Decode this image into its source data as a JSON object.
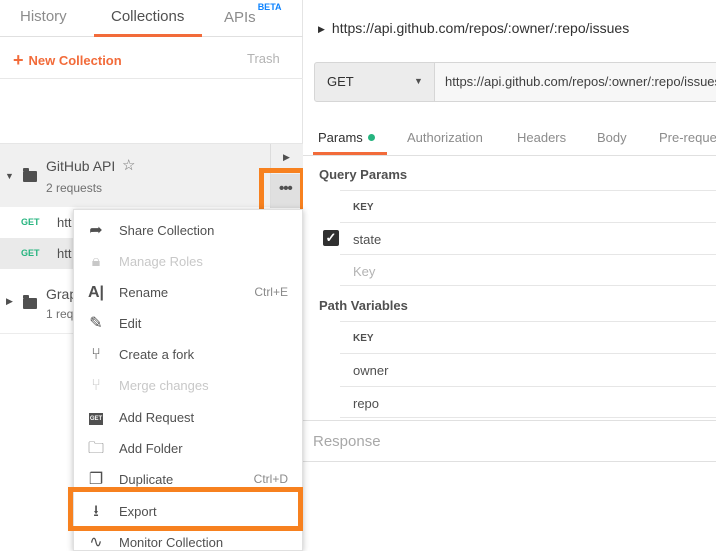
{
  "sidebar": {
    "tabs": {
      "history": "History",
      "collections": "Collections",
      "apis": "APIs",
      "apis_badge": "BETA"
    },
    "new_collection": "New Collection",
    "trash": "Trash",
    "collections": [
      {
        "name": "GitHub API",
        "count": "2 requests"
      },
      {
        "name": "Grap",
        "count": "1 req"
      }
    ],
    "requests": [
      {
        "method": "GET",
        "url": "htt"
      },
      {
        "method": "GET",
        "url": "htt"
      }
    ]
  },
  "menu": {
    "items": [
      {
        "label": "Share Collection",
        "shortcut": ""
      },
      {
        "label": "Manage Roles",
        "shortcut": ""
      },
      {
        "label": "Rename",
        "shortcut": "Ctrl+E"
      },
      {
        "label": "Edit",
        "shortcut": ""
      },
      {
        "label": "Create a fork",
        "shortcut": ""
      },
      {
        "label": "Merge changes",
        "shortcut": ""
      },
      {
        "label": "Add Request",
        "shortcut": ""
      },
      {
        "label": "Add Folder",
        "shortcut": ""
      },
      {
        "label": "Duplicate",
        "shortcut": "Ctrl+D"
      },
      {
        "label": "Export",
        "shortcut": ""
      },
      {
        "label": "Monitor Collection",
        "shortcut": ""
      }
    ],
    "get_chip": "GET"
  },
  "main": {
    "url_title": "https://api.github.com/repos/:owner/:repo/issues",
    "method": "GET",
    "url_value": "https://api.github.com/repos/:owner/:repo/issues",
    "tabs": {
      "params": "Params",
      "authorization": "Authorization",
      "headers": "Headers",
      "body": "Body",
      "pre": "Pre-reque"
    },
    "query_params": {
      "title": "Query Params",
      "key_header": "KEY",
      "row1": "state",
      "placeholder": "Key"
    },
    "path_variables": {
      "title": "Path Variables",
      "key_header": "KEY",
      "row1": "owner",
      "row2": "repo"
    },
    "response": "Response"
  },
  "colors": {
    "accent": "#f26b3a",
    "highlight": "#f7811f",
    "get_method": "#26b47f",
    "beta": "#0d83ff"
  }
}
